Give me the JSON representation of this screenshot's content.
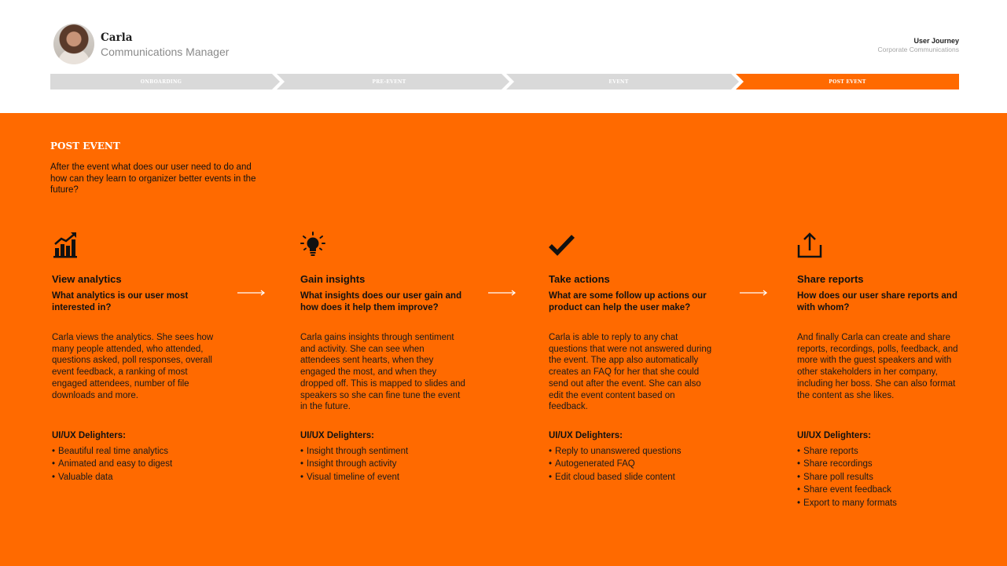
{
  "persona": {
    "name": "Carla",
    "role": "Communications Manager"
  },
  "document": {
    "title": "User Journey",
    "subtitle": "Corporate Communications"
  },
  "stages": [
    {
      "label": "ONBOARDING",
      "active": false
    },
    {
      "label": "PRE-EVENT",
      "active": false
    },
    {
      "label": "EVENT",
      "active": false
    },
    {
      "label": "POST EVENT",
      "active": true
    }
  ],
  "colors": {
    "accent": "#ff6a00",
    "inactive_stage": "#d9d9d9"
  },
  "section": {
    "title": "POST EVENT",
    "description": "After the event what does our user need to do and how can they learn to organizer better events in the future?"
  },
  "steps": [
    {
      "icon": "analytics-chart-icon",
      "title": "View analytics",
      "question": "What analytics is our user most interested in?",
      "body": "Carla views the analytics. She sees how many people attended, who attended, questions asked, poll responses, overall event feedback, a ranking of most engaged attendees, number of file downloads and more.",
      "delighters_title": "UI/UX Delighters:",
      "delighters": [
        "Beautiful real time analytics",
        "Animated and easy to digest",
        "Valuable data"
      ]
    },
    {
      "icon": "lightbulb-icon",
      "title": "Gain insights",
      "question": "What insights does our user gain and how does it help them improve?",
      "body": "Carla gains insights through sentiment and activity. She can see when attendees sent hearts, when they engaged the most, and when they dropped off. This is mapped to slides and speakers so she can fine tune the event in the future.",
      "delighters_title": "UI/UX Delighters:",
      "delighters": [
        "Insight through sentiment",
        "Insight through activity",
        "Visual timeline of event"
      ]
    },
    {
      "icon": "checkmark-icon",
      "title": "Take actions",
      "question": "What are some follow up actions our product can help the user make?",
      "body": "Carla is able to reply to any chat questions that were not answered during the event. The app also automatically creates an FAQ for her that she could send out after the event.  She can also edit the event content based on feedback.",
      "delighters_title": "UI/UX Delighters:",
      "delighters": [
        "Reply to unanswered questions",
        "Autogenerated FAQ",
        "Edit cloud based slide content"
      ]
    },
    {
      "icon": "share-upload-icon",
      "title": "Share reports",
      "question": "How does our user share reports and with whom?",
      "body": "And finally Carla can create and share reports, recordings, polls, feedback, and more with the guest speakers and with other stakeholders in her company, including her boss. She can also format the content as she likes.",
      "delighters_title": "UI/UX Delighters:",
      "delighters": [
        "Share reports",
        "Share recordings",
        "Share poll results",
        "Share event feedback",
        "Export to many formats"
      ]
    }
  ]
}
